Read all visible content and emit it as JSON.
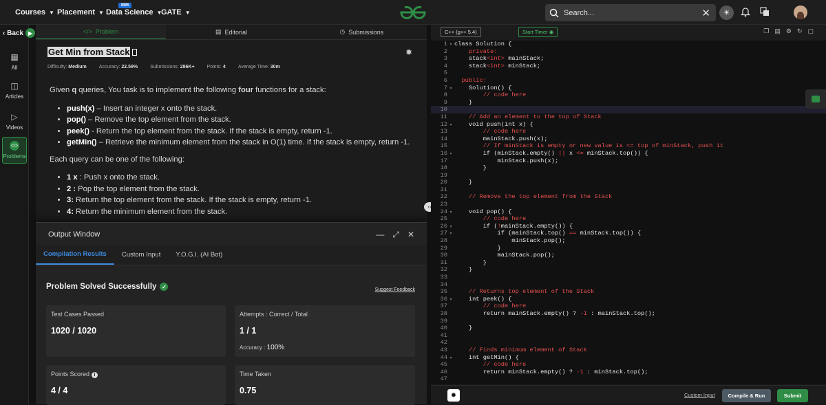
{
  "nav": {
    "items": [
      "Courses",
      "Placement",
      "Data Science",
      "GATE"
    ],
    "badge": "IBM",
    "search_placeholder": "Search..."
  },
  "sidebar": {
    "back": "Back",
    "items": [
      "All",
      "Articles",
      "Videos",
      "Problems"
    ],
    "active": "Problems"
  },
  "tabs": [
    "Problem",
    "Editorial",
    "Submissions"
  ],
  "problem": {
    "title": "Get Min from Stack",
    "meta": {
      "difficulty_label": "Difficulty:",
      "difficulty": "Medium",
      "accuracy_label": "Accuracy:",
      "accuracy": "22.59%",
      "submissions_label": "Submissions:",
      "submissions": "286K+",
      "points_label": "Points:",
      "points": "4",
      "avg_time_label": "Average Time:",
      "avg_time": "30m"
    },
    "intro": {
      "p1": "Given ",
      "q": "q",
      "p2": " queries, You task is to implement the following ",
      "four": "four",
      "p3": " functions for a stack:"
    },
    "functions": [
      {
        "name": "push(x)",
        "desc": " – Insert an integer x onto the stack."
      },
      {
        "name": "pop()",
        "desc": " – Remove the top element from the stack."
      },
      {
        "name": "peek()",
        "desc": " - Return the top element from the stack. If the stack is empty, return -1."
      },
      {
        "name": "getMin()",
        "desc": " – Retrieve the minimum element from the stack in O(1) time. If the stack is empty, return -1."
      }
    ],
    "query_intro": "Each query can be one of the following:",
    "queries": [
      {
        "name": "1 x",
        "desc": " : Push x onto the stack."
      },
      {
        "name": "2 :",
        "desc": " Pop the top element from the stack."
      },
      {
        "name": "3:",
        "desc": " Return the top element from the stack. If the stack is empty, return -1."
      },
      {
        "name": "4:",
        "desc": " Return the minimum element from the stack."
      }
    ]
  },
  "output": {
    "title": "Output Window",
    "tabs": [
      "Compilation Results",
      "Custom Input",
      "Y.O.G.I. (AI Bot)"
    ],
    "status": "Problem Solved Successfully",
    "suggest": "Suggest Feedback",
    "test_cases_label": "Test Cases Passed",
    "test_cases": "1020 / 1020",
    "attempts_label": "Attempts : Correct / Total",
    "attempts": "1 / 1",
    "accuracy_label": "Accuracy :",
    "accuracy": "100%",
    "points_label": "Points Scored",
    "points": "4 / 4",
    "time_label": "Time Taken",
    "time": "0.75"
  },
  "editor": {
    "language": "C++ (g++ 5.4)",
    "timer": "Start Timer",
    "current_line": 10,
    "lines": [
      "class Solution {",
      "    private:",
      "    stack<int> mainStack;",
      "    stack<int> minStack;",
      "",
      "  public:",
      "    Solution() {",
      "        // code here",
      "    }",
      "",
      "    // Add an element to the top of Stack",
      "    void push(int x) {",
      "        // code here",
      "        mainStack.push(x);",
      "        // If minStack is empty or new value is <= top of minStack, push it",
      "        if (minStack.empty() || x <= minStack.top()) {",
      "            minStack.push(x);",
      "        }",
      "",
      "    }",
      "",
      "    // Remove the top element from the Stack",
      "",
      "    void pop() {",
      "        // code here",
      "        if (!mainStack.empty()) {",
      "            if (mainStack.top() == minStack.top()) {",
      "                minStack.pop();",
      "            }",
      "            mainStack.pop();",
      "        }",
      "    }",
      "",
      "",
      "    // Returns top element of the Stack",
      "    int peek() {",
      "        // code here",
      "        return mainStack.empty() ? -1 : mainStack.top();",
      "",
      "    }",
      "",
      "",
      "    // Finds minimum element of Stack",
      "    int getMin() {",
      "        // code here",
      "        return minStack.empty() ? -1 : minStack.top();",
      ""
    ],
    "fold_lines": [
      1,
      7,
      12,
      16,
      24,
      26,
      27,
      36,
      44
    ],
    "footer": {
      "custom_input": "Custom Input",
      "run": "Compile & Run",
      "submit": "Submit"
    }
  }
}
